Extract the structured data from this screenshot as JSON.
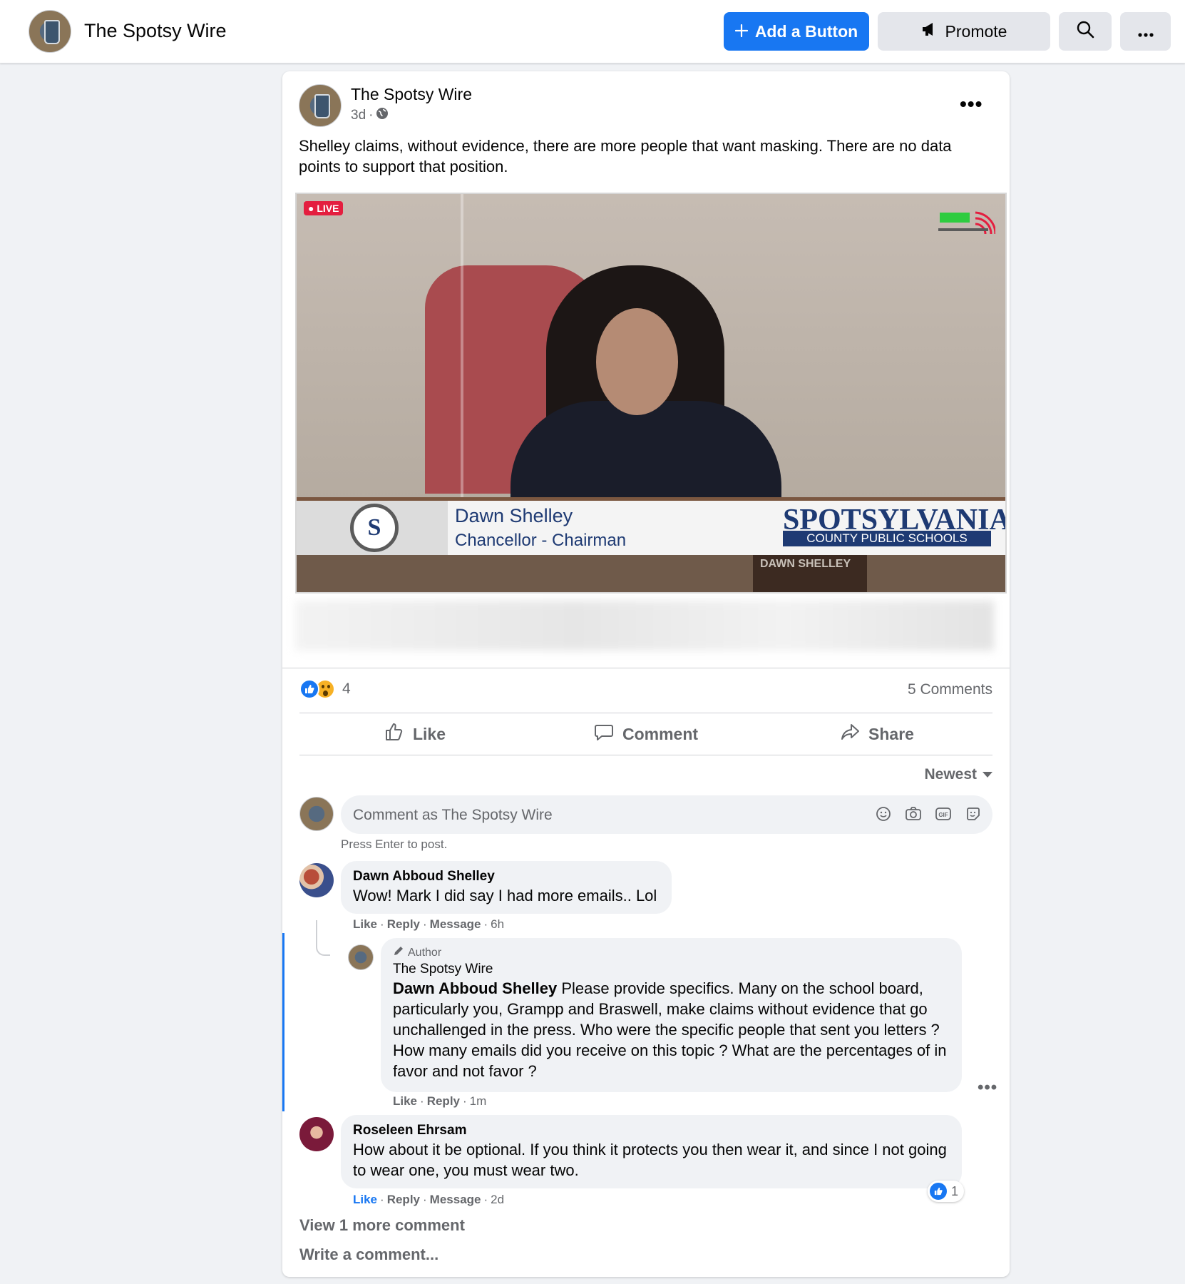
{
  "header": {
    "page_name": "The Spotsy Wire",
    "add_button_label": "Add a Button",
    "promote_label": "Promote"
  },
  "post": {
    "author": "The Spotsy Wire",
    "time": "3d",
    "text": "Shelley claims, without evidence, there are more people that want masking.  There are no data points to support that position.",
    "video": {
      "live_label": "LIVE",
      "lower_third_name": "Dawn Shelley",
      "lower_third_title": "Chancellor - Chairman",
      "school_name": "SPOTSYLVANIA",
      "school_sub": "COUNTY PUBLIC SCHOOLS",
      "nameplate": "DAWN SHELLEY",
      "logo_letter": "S"
    },
    "reaction_count": "4",
    "comments_count": "5 Comments",
    "actions": {
      "like": "Like",
      "comment": "Comment",
      "share": "Share"
    },
    "sort_label": "Newest",
    "compose_placeholder": "Comment as The Spotsy Wire",
    "press_enter": "Press Enter to post."
  },
  "comments": [
    {
      "name": "Dawn Abboud Shelley",
      "text": "Wow! Mark I did say I had more emails.. Lol",
      "like": "Like",
      "reply": "Reply",
      "message": "Message",
      "time": "6h"
    },
    {
      "badge": "Author",
      "name": "The Spotsy Wire",
      "mention": "Dawn Abboud Shelley",
      "text": " Please provide specifics. Many on the school board, particularly you, Grampp and Braswell, make claims without evidence that go unchallenged in the press. Who were the specific people that sent you letters ? How many emails did you receive on this topic ? What are the percentages of in favor and not favor ?",
      "like": "Like",
      "reply": "Reply",
      "time": "1m"
    },
    {
      "name": "Roseleen Ehrsam",
      "text": "How about it be optional. If you think it protects you then wear it, and since I not going to wear one, you must wear two.",
      "like": "Like",
      "reply": "Reply",
      "message": "Message",
      "time": "2d",
      "like_count": "1"
    }
  ],
  "footer": {
    "view_more": "View 1 more comment",
    "write_comment": "Write a comment..."
  },
  "colors": {
    "accent": "#1877f2",
    "wow": "#f7b125"
  }
}
